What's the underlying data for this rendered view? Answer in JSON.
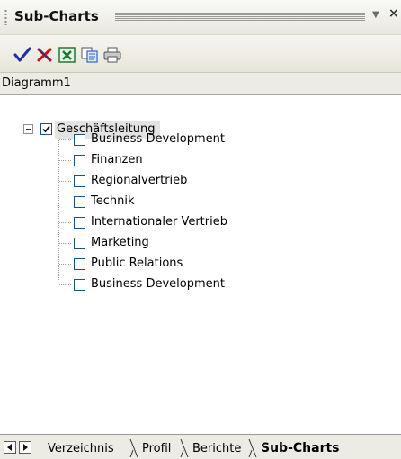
{
  "panel": {
    "title": "Sub-Charts",
    "menu_icon": "chevron-down-icon",
    "close_icon": "close-icon"
  },
  "toolbar": {
    "buttons": [
      {
        "name": "confirm-button",
        "icon": "checkmark-icon",
        "color": "#1d2fa8"
      },
      {
        "name": "cancel-button",
        "icon": "x-mark-icon",
        "color": "#c81414"
      },
      {
        "name": "excel-export-button",
        "icon": "excel-icon",
        "color": "#1f7a2f"
      },
      {
        "name": "copy-button",
        "icon": "copy-icon",
        "color": "#2f64c4"
      },
      {
        "name": "print-button",
        "icon": "printer-icon",
        "color": "#666666"
      }
    ]
  },
  "header": {
    "label": "Diagramm1"
  },
  "tree": {
    "root": {
      "label": "Geschäftsleitung",
      "checked": true,
      "expanded": true
    },
    "items": [
      {
        "label": "Business Development",
        "checked": false
      },
      {
        "label": "Finanzen",
        "checked": false
      },
      {
        "label": "Regionalvertrieb",
        "checked": false
      },
      {
        "label": "Technik",
        "checked": false
      },
      {
        "label": "Internationaler Vertrieb",
        "checked": false
      },
      {
        "label": "Marketing",
        "checked": false
      },
      {
        "label": "Public Relations",
        "checked": false
      },
      {
        "label": "Business Development",
        "checked": false
      }
    ]
  },
  "tabs": {
    "items": [
      {
        "label": "Verzeichnis",
        "active": false
      },
      {
        "label": "Profil",
        "active": false
      },
      {
        "label": "Berichte",
        "active": false
      },
      {
        "label": "Sub-Charts",
        "active": true
      }
    ]
  }
}
